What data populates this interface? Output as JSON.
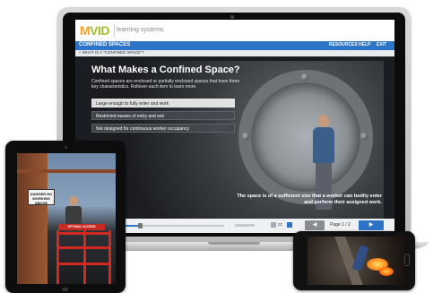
{
  "app": {
    "logo_mark": "M",
    "logo_text": "VID",
    "logo_subtitle": "learning systems"
  },
  "nav": {
    "course_title": "CONFINED SPACES",
    "links": [
      "RESOURCES",
      "HELP",
      "EXIT"
    ]
  },
  "breadcrumb": "» WHAT IS A \"CONFINED SPACE\"?",
  "lesson": {
    "title": "What Makes a Confined Space?",
    "intro": "Confined spaces are enclosed or partially enclosed spaces that have three key characteristics. Rollover each item to learn more.",
    "items": [
      "Large enough to fully enter and work",
      "Restricted means of entry and exit",
      "Not designed for continuous worker occupancy"
    ],
    "caption": "The space is of a sufficient size that a worker can bodily enter and perform their assigned work."
  },
  "controls": {
    "progress": 0.22,
    "cc_label": "cc",
    "prev_symbol": "◀",
    "page_indicator": "Page 1 / 2",
    "next_symbol": "▶"
  },
  "tablet": {
    "sign_text": "DANGER NO WORKING ABOVE",
    "lift_label": "OPTIMAL ACCESS"
  },
  "colors": {
    "nav_blue": "#2d74c6",
    "logo_green": "#9fbf2f",
    "logo_orange": "#f2a22a",
    "lift_red": "#d2281f"
  }
}
